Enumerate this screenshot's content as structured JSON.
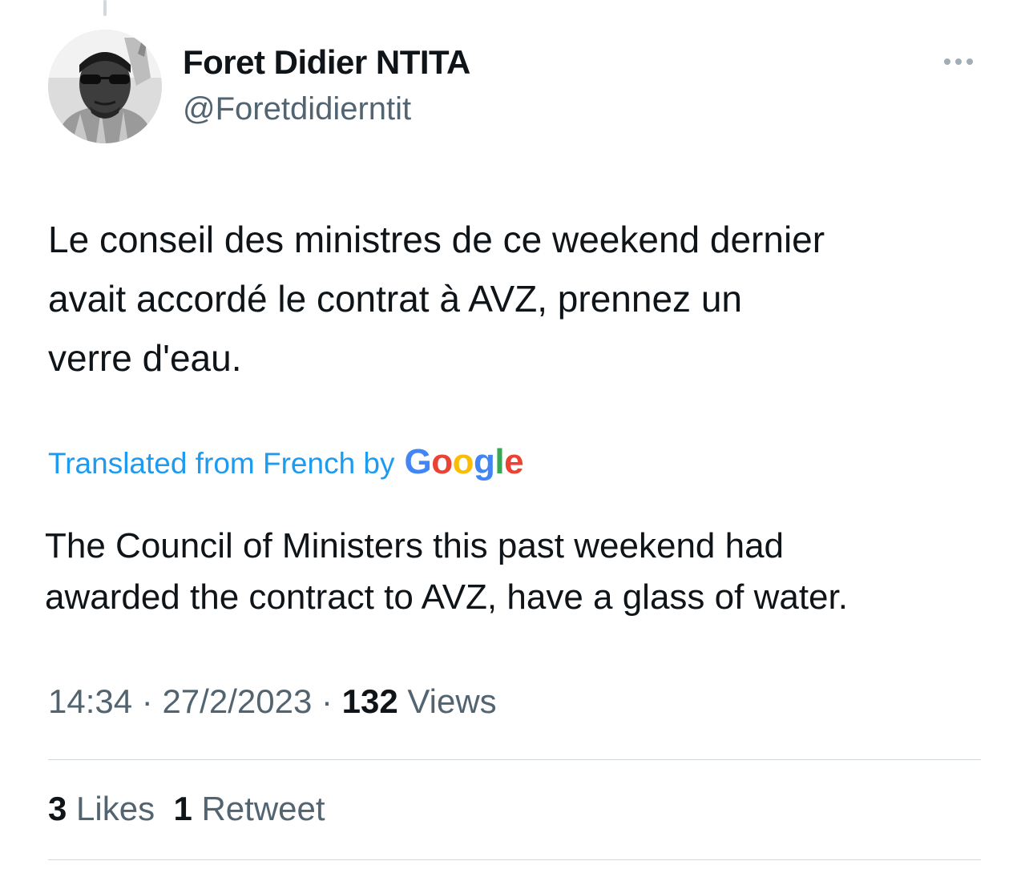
{
  "tweet": {
    "author": {
      "display_name": "Foret Didier NTITA",
      "handle": "@Foretdidierntit"
    },
    "more_icon": "ellipsis-icon",
    "text_lines": [
      "Le conseil des ministres de ce weekend dernier",
      "avait accordé le contrat à AVZ, prennez un",
      "verre d'eau."
    ],
    "translation": {
      "label": "Translated from French by",
      "provider": "Google",
      "provider_letters": [
        "G",
        "o",
        "o",
        "g",
        "l",
        "e"
      ],
      "provider_colors": [
        "#4285F4",
        "#EA4335",
        "#FBBC05",
        "#4285F4",
        "#34A853",
        "#EA4335"
      ],
      "text_lines": [
        "The Council of Ministers this past weekend had",
        "awarded the contract to AVZ, have a glass of water."
      ]
    },
    "meta": {
      "time": "14:34",
      "separator": "·",
      "date": "27/2/2023",
      "views_count": "132",
      "views_label": "Views"
    },
    "stats": {
      "likes_count": "3",
      "likes_label": "Likes",
      "retweets_count": "1",
      "retweets_label": "Retweet"
    },
    "colors": {
      "text_primary": "#0f1419",
      "text_secondary": "#536471",
      "link": "#1d9bf0",
      "divider": "#cfd9de"
    }
  }
}
